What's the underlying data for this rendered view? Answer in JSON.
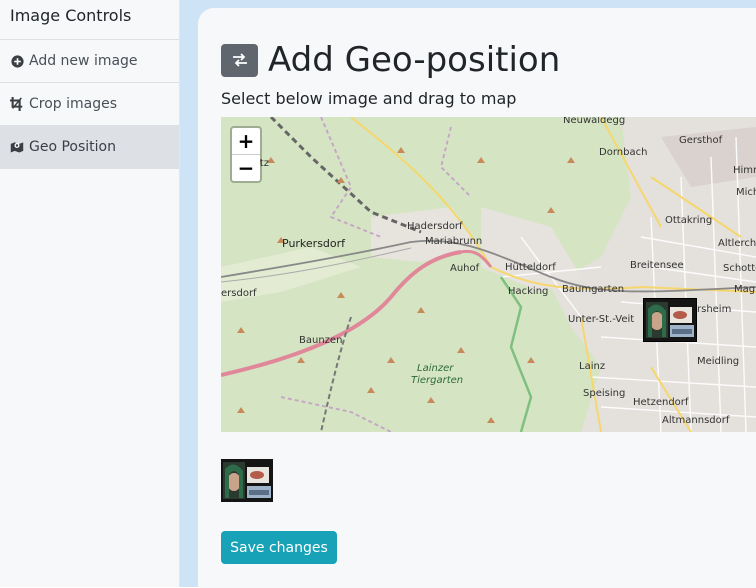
{
  "sidebar": {
    "title": "Image Controls",
    "items": [
      {
        "label": "Add new image",
        "icon": "plus-circle-icon",
        "active": false
      },
      {
        "label": "Crop images",
        "icon": "crop-icon",
        "active": false
      },
      {
        "label": "Geo Position",
        "icon": "map-marker-icon",
        "active": true
      }
    ]
  },
  "main": {
    "title": "Add Geo-position",
    "title_icon": "swap-arrows-icon",
    "subtitle": "Select below image and drag to map",
    "save_label": "Save changes"
  },
  "map": {
    "zoom_in": "+",
    "zoom_out": "−",
    "places": {
      "neuwaldegg": "Neuwaldegg",
      "gersthof": "Gersthof",
      "dornbach": "Dornbach",
      "himr": "Himr",
      "mich": "Mich",
      "hadersdorf": "Hadersdorf",
      "mariabrunn": "Mariabrunn",
      "ottakring": "Ottakring",
      "altlerch": "Altlerch",
      "purkersdorf": "Purkersdorf",
      "auhof": "Auhof",
      "hutteldorf": "Hütteldorf",
      "breitensee": "Breitensee",
      "schotte": "Schotte",
      "mag": "Mag",
      "hacking": "Hacking",
      "baumgarten": "Baumgarten",
      "unterstveit": "Unter-St.-Veit",
      "rsheim": "rsheim",
      "ersdorf": "ersdorf",
      "baunzen": "Baunzen",
      "lainzer": "Lainzer",
      "tiergarten": "Tiergarten",
      "lainz": "Lainz",
      "meidling": "Meidling",
      "speising": "Speising",
      "hetzendorf": "Hetzendorf",
      "altmannsdorf": "Altmannsdorf",
      "itz": "itz",
      "ottkring_partial": "Ottakring"
    }
  },
  "colors": {
    "accent": "#17a2b8",
    "title_button": "#5f666d",
    "sidebar_active": "#dde1e6",
    "gutter": "#cfe3f7"
  }
}
